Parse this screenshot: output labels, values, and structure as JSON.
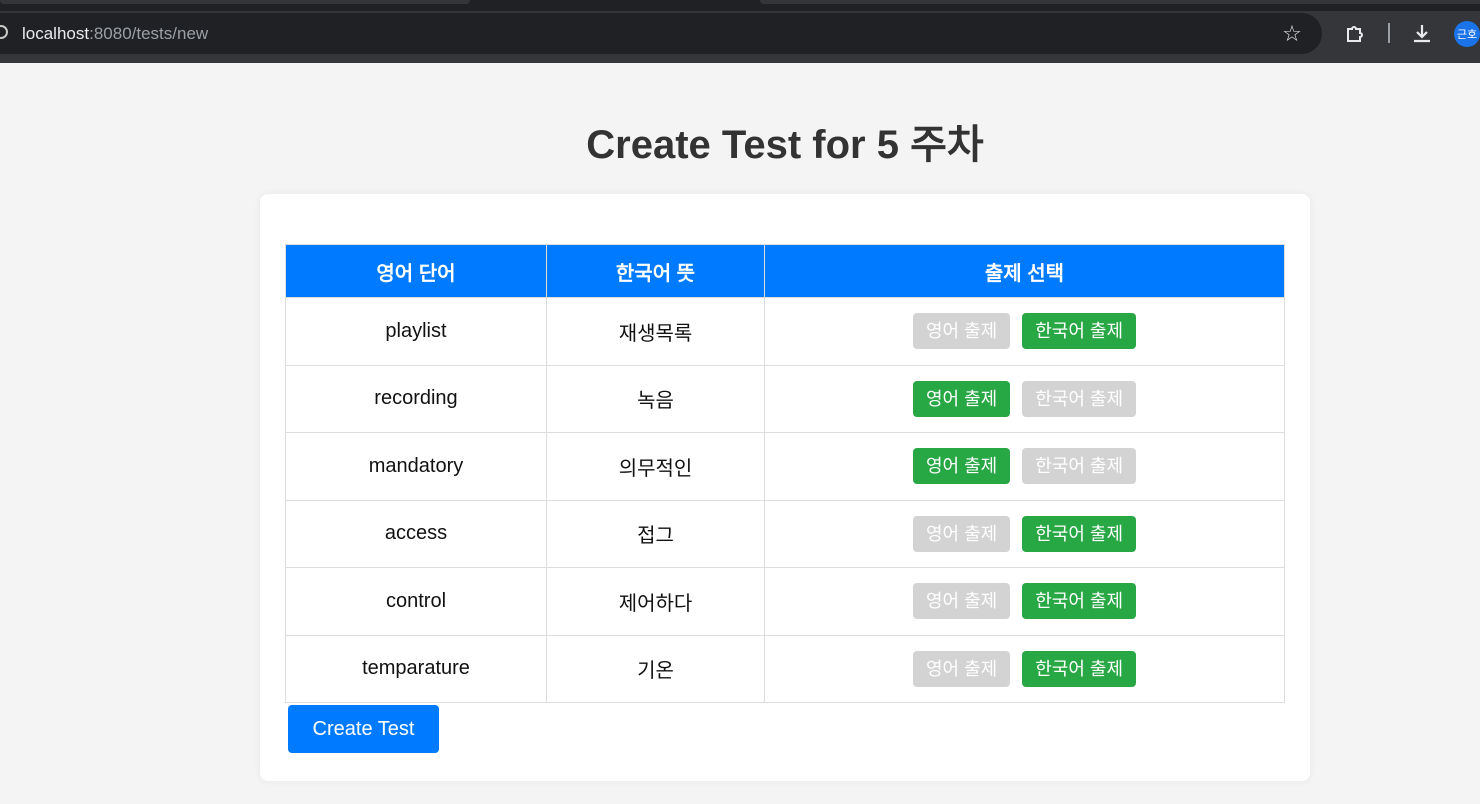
{
  "browser": {
    "url_host": "localhost",
    "url_path": ":8080/tests/new",
    "avatar_text": "근호",
    "icons": [
      "info-icon",
      "star-icon",
      "extensions-icon",
      "download-icon"
    ]
  },
  "page": {
    "title": "Create Test for 5 주차"
  },
  "table": {
    "headers": [
      "영어 단어",
      "한국어 뜻",
      "출제 선택"
    ],
    "rows": [
      {
        "english": "playlist",
        "korean": "재생목록",
        "english_btn": "영어 출제",
        "korean_btn": "한국어 출제",
        "selected": "korean"
      },
      {
        "english": "recording",
        "korean": "녹음",
        "english_btn": "영어 출제",
        "korean_btn": "한국어 출제",
        "selected": "english"
      },
      {
        "english": "mandatory",
        "korean": "의무적인",
        "english_btn": "영어 출제",
        "korean_btn": "한국어 출제",
        "selected": "english"
      },
      {
        "english": "access",
        "korean": "접그",
        "english_btn": "영어 출제",
        "korean_btn": "한국어 출제",
        "selected": "korean"
      },
      {
        "english": "control",
        "korean": "제어하다",
        "english_btn": "영어 출제",
        "korean_btn": "한국어 출제",
        "selected": "korean"
      },
      {
        "english": "temparature",
        "korean": "기온",
        "english_btn": "영어 출제",
        "korean_btn": "한국어 출제",
        "selected": "korean"
      }
    ]
  },
  "actions": {
    "create_label": "Create Test"
  },
  "colors": {
    "header_blue": "#007bff",
    "selected_green": "#28a745",
    "unselected_gray": "#d3d3d3",
    "chrome_dark": "#35363a"
  }
}
